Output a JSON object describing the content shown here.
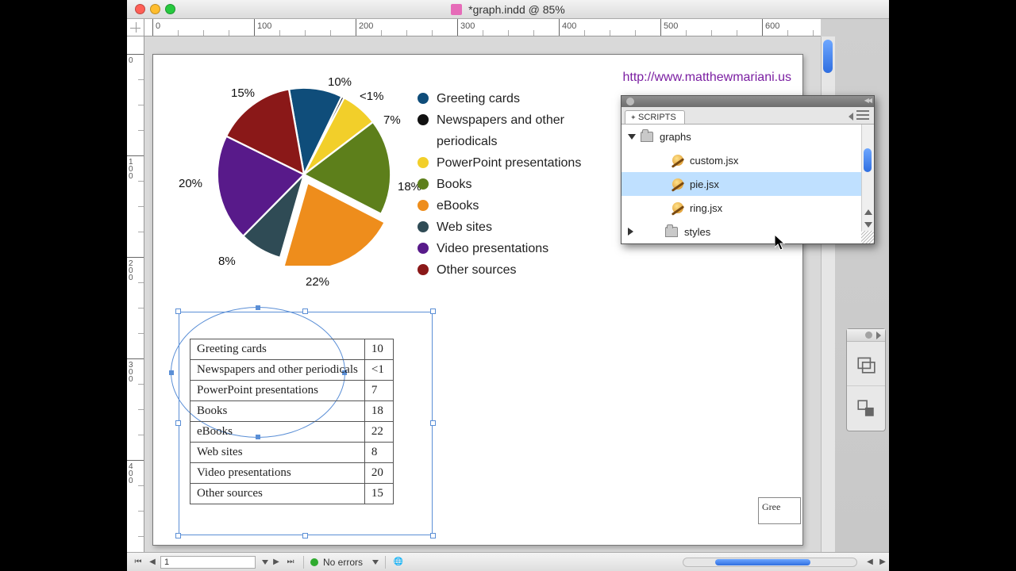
{
  "window": {
    "title": "*graph.indd @ 85%"
  },
  "url": "http://www.matthewmariani.us",
  "ruler_h": [
    0,
    100,
    200,
    300,
    400,
    500,
    600
  ],
  "ruler_v": [
    0,
    100,
    200,
    300,
    400
  ],
  "colors": {
    "greeting": "#0f4d7a",
    "news": "#111111",
    "ppt": "#f2cf2a",
    "books": "#5d7f1b",
    "ebooks": "#ee8d1c",
    "web": "#2f4b55",
    "video": "#581a8a",
    "other": "#8a1818"
  },
  "legend": [
    {
      "key": "greeting",
      "label": "Greeting cards"
    },
    {
      "key": "news",
      "label": "Newspapers and other periodicals"
    },
    {
      "key": "ppt",
      "label": "PowerPoint presentations"
    },
    {
      "key": "books",
      "label": "Books"
    },
    {
      "key": "ebooks",
      "label": "eBooks"
    },
    {
      "key": "web",
      "label": "Web sites"
    },
    {
      "key": "video",
      "label": "Video presentations"
    },
    {
      "key": "other",
      "label": "Other sources"
    }
  ],
  "pct_labels": {
    "greeting": "10%",
    "news": "<1%",
    "ppt": "7%",
    "books": "18%",
    "ebooks": "22%",
    "web": "8%",
    "video": "20%",
    "other": "15%"
  },
  "chart_data": {
    "type": "pie",
    "title": "",
    "series": [
      {
        "name": "Greeting cards",
        "value": 10,
        "display": "10%",
        "color": "#0f4d7a"
      },
      {
        "name": "Newspapers and other periodicals",
        "value": 0.5,
        "display": "<1%",
        "color": "#111111"
      },
      {
        "name": "PowerPoint presentations",
        "value": 7,
        "display": "7%",
        "color": "#f2cf2a"
      },
      {
        "name": "Books",
        "value": 18,
        "display": "18%",
        "color": "#5d7f1b"
      },
      {
        "name": "eBooks",
        "value": 22,
        "display": "22%",
        "color": "#ee8d1c"
      },
      {
        "name": "Web sites",
        "value": 8,
        "display": "8%",
        "color": "#2f4b55"
      },
      {
        "name": "Video presentations",
        "value": 20,
        "display": "20%",
        "color": "#581a8a"
      },
      {
        "name": "Other sources",
        "value": 15,
        "display": "15%",
        "color": "#8a1818"
      }
    ]
  },
  "table": [
    {
      "label": "Greeting cards",
      "value": "10"
    },
    {
      "label": "Newspapers and other periodicals",
      "value": "<1"
    },
    {
      "label": "PowerPoint presentations",
      "value": "7"
    },
    {
      "label": "Books",
      "value": "18"
    },
    {
      "label": "eBooks",
      "value": "22"
    },
    {
      "label": "Web sites",
      "value": "8"
    },
    {
      "label": "Video presentations",
      "value": "20"
    },
    {
      "label": "Other sources",
      "value": "15"
    }
  ],
  "scripts_panel": {
    "title": "SCRIPTS",
    "tree": {
      "folder1": "graphs",
      "items": [
        "custom.jsx",
        "pie.jsx",
        "ring.jsx"
      ],
      "selected_index": 1,
      "folder2": "styles"
    }
  },
  "status": {
    "page": "1",
    "preflight": "No errors"
  },
  "snippet": "Gree"
}
